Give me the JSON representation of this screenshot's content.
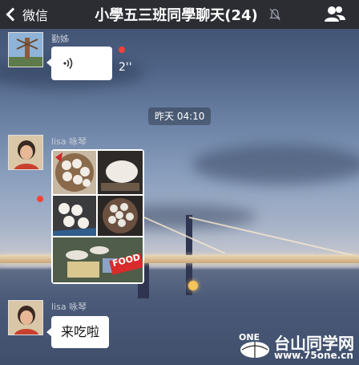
{
  "navbar": {
    "back_label": "微信",
    "title": "小學五三班同學聊天(24)",
    "mute_icon": "bell-muted-icon",
    "members_icon": "group-members-icon"
  },
  "messages": [
    {
      "type": "voice",
      "sender": "勤姊",
      "duration": "2''",
      "icon": "voice-wave-icon",
      "unread": true
    },
    {
      "type": "timestamp",
      "text": "昨天 04:10"
    },
    {
      "type": "image",
      "sender": "lisa 咏琴",
      "image_caption": "FOOD"
    },
    {
      "type": "text",
      "sender": "lisa 咏琴",
      "text": "来吃啦"
    }
  ],
  "watermark": {
    "logo_text": "ONE",
    "site_name": "台山同学网",
    "url": "www.75one.cn"
  },
  "colors": {
    "navbar_bg": "#2b2d33",
    "bubble_bg": "#ffffff",
    "unread_dot": "#f44336"
  }
}
